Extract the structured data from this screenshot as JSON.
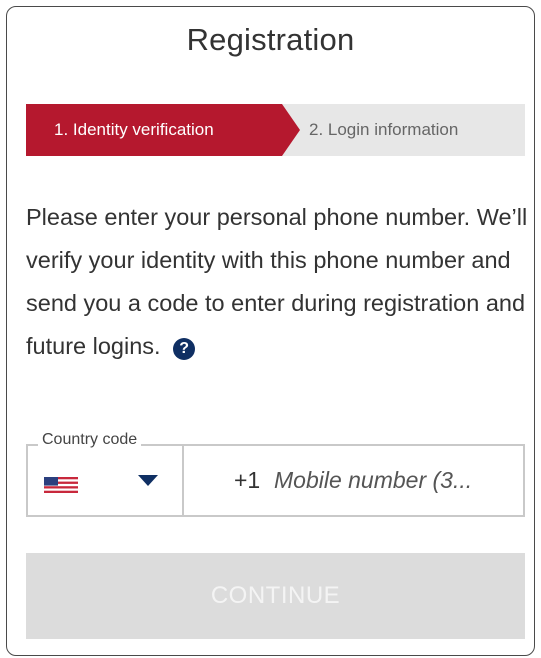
{
  "header": {
    "title": "Registration"
  },
  "stepper": {
    "steps": [
      {
        "label": "1. Identity verification",
        "state": "active"
      },
      {
        "label": "2. Login information",
        "state": "inactive"
      }
    ],
    "active_color": "#b5182e",
    "inactive_color": "#e7e7e7"
  },
  "instructions": {
    "text": "Please enter your personal phone number. We’ll verify your identity with this phone number and send you a code to enter during registration and future logins.",
    "help_icon": "question-circle-icon",
    "help_symbol": "?"
  },
  "phone": {
    "country_label": "Country code",
    "country_selected": "United States",
    "country_icon": "us-flag-icon",
    "dropdown_icon": "caret-down-icon",
    "prefix": "+1",
    "placeholder": "Mobile number (3..."
  },
  "actions": {
    "continue_label": "CONTINUE",
    "continue_enabled": false
  }
}
